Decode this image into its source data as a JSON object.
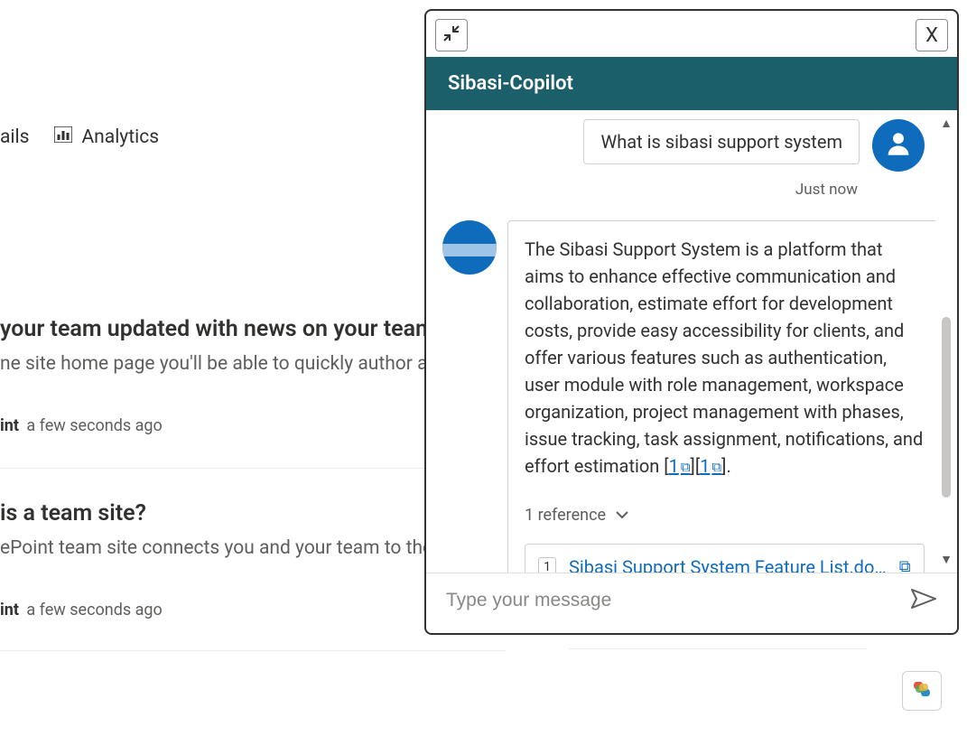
{
  "bg": {
    "nav_ails": "ails",
    "nav_analytics": "Analytics",
    "block1_title": "your team updated with news on your team",
    "block1_sub": "ne site home page you'll be able to quickly author a",
    "block1_meta_who": "int",
    "block1_meta_time": "a few seconds ago",
    "block2_title": "is a team site?",
    "block2_sub": "ePoint team site connects you and your team to the",
    "block2_meta_who": "int",
    "block2_meta_time": "a few seconds ago"
  },
  "chat": {
    "header_title": "Sibasi-Copilot",
    "close_label": "X",
    "user_message": "What is sibasi support system",
    "timestamp": "Just now",
    "bot_message_part1": "The Sibasi Support System is a platform that aims to enhance effective communication and collaboration, estimate effort for development costs, provide easy accessibility for clients, and offer various features such as authentication, user module with role management, workspace organization, project management with phases, issue tracking, task assignment, notifications, and effort estimation ",
    "citation1": "1",
    "citation2": "1",
    "bot_message_tail": ".",
    "references_label": "1 reference",
    "reference_num": "1",
    "reference_title": "Sibasi Support System Feature List.do…",
    "input_placeholder": "Type your message"
  }
}
